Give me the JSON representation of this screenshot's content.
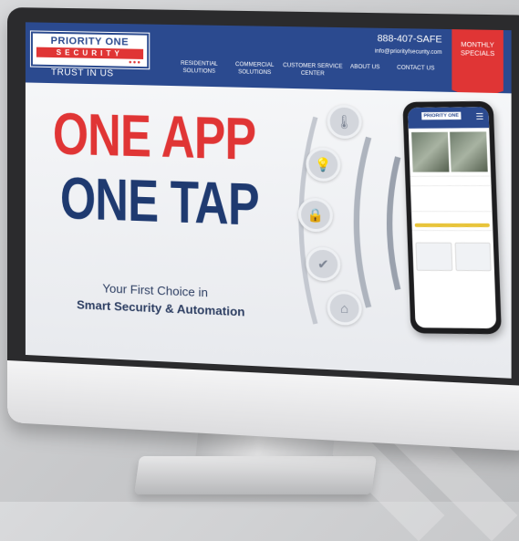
{
  "header": {
    "logo_top": "PRIORITY ONE",
    "logo_bottom": "SECURITY",
    "tagline": "TRUST IN US",
    "phone": "888-407-SAFE",
    "email": "info@priorityfsecurity.com",
    "nav": [
      {
        "line1": "RESIDENTIAL",
        "line2": "SOLUTIONS"
      },
      {
        "line1": "COMMERCIAL",
        "line2": "SOLUTIONS"
      },
      {
        "line1": "CUSTOMER SERVICE",
        "line2": "CENTER"
      },
      {
        "line1": "ABOUT US",
        "line2": ""
      },
      {
        "line1": "CONTACT US",
        "line2": ""
      }
    ],
    "specials_line1": "MONTHLY",
    "specials_line2": "SPECIALS"
  },
  "hero": {
    "headline1": "ONE APP",
    "headline2": "ONE TAP",
    "subtitle1": "Your First Choice in",
    "subtitle2": "Smart Security & Automation"
  },
  "icons": [
    "thermostat-icon",
    "lightbulb-icon",
    "smart-lock-icon",
    "shield-check-icon",
    "garage-icon"
  ],
  "colors": {
    "brand_blue": "#2b4a8f",
    "brand_red": "#e03535",
    "navy": "#1f3a70"
  }
}
